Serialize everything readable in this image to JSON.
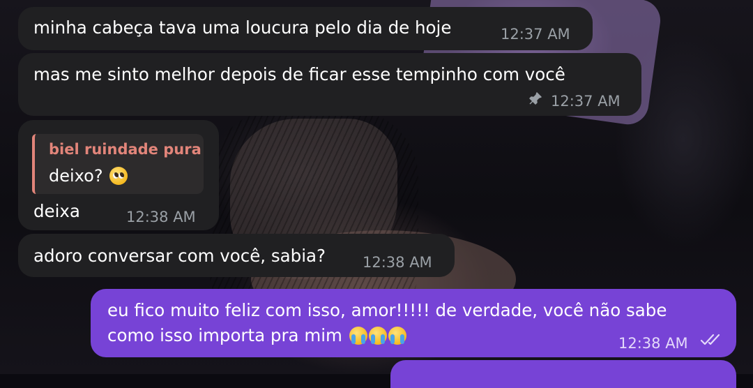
{
  "messages": [
    {
      "id": "m1",
      "direction": "incoming",
      "text": "minha cabeça tava uma loucura pelo dia de hoje",
      "time": "12:37 AM"
    },
    {
      "id": "m2",
      "direction": "incoming",
      "text": "mas me sinto melhor depois de ficar esse tempinho com você",
      "time": "12:37 AM",
      "pinned": true,
      "pin_icon": "pin-icon"
    },
    {
      "id": "m3",
      "direction": "incoming",
      "reply": {
        "author": "biel ruindade pura",
        "text": "deixo?",
        "emoji": "pleading-face"
      },
      "text": "deixa",
      "time": "12:38 AM"
    },
    {
      "id": "m4",
      "direction": "incoming",
      "text": "adoro conversar com você, sabia?",
      "time": "12:38 AM"
    },
    {
      "id": "m5",
      "direction": "outgoing",
      "lines": [
        "eu fico muito feliz com isso, amor!!!!! de verdade, você não sabe",
        "como isso importa pra mim"
      ],
      "emoji": [
        "loudly-crying-face",
        "loudly-crying-face",
        "loudly-crying-face"
      ],
      "time": "12:38 AM",
      "status_icon": "double-check-icon"
    }
  ],
  "colors": {
    "incoming_bubble": "#202022",
    "outgoing_bubble": "#7743d6",
    "reply_accent": "#e2857a",
    "timestamp": "#9aa0a6"
  }
}
